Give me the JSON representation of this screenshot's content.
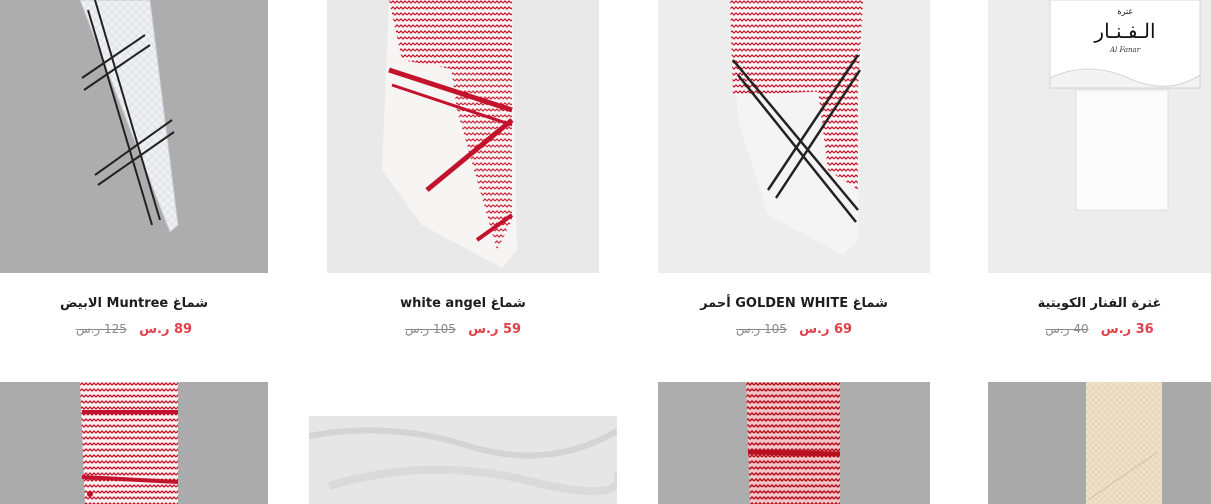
{
  "products": [
    {
      "title": "شماغ Muntree الابيض",
      "price": "89 ر.س",
      "old_price": "125 ر.س",
      "bg": "#adadad"
    },
    {
      "title": "شماغ white angel",
      "price": "59 ر.س",
      "old_price": "105 ر.س",
      "bg": "#e9e9e9"
    },
    {
      "title": "شماغ GOLDEN WHITE أحمر",
      "price": "69 ر.س",
      "old_price": "105 ر.س",
      "bg": "#ededed"
    },
    {
      "title": "غترة الفنار الكويتية",
      "price": "36 ر.س",
      "old_price": "40 ر.س",
      "bg": "#ededed"
    }
  ],
  "second_row_bgs": [
    "#ababab",
    "#e6e6e6",
    "#adadad",
    "#a9a9a9"
  ],
  "brand_packaging": {
    "arabic_name": "الـفـنـار",
    "arabic_small": "غترة",
    "latin": "Al Fanar"
  },
  "accent_color": "#e0414b",
  "red_pattern_color": "#c3122b"
}
